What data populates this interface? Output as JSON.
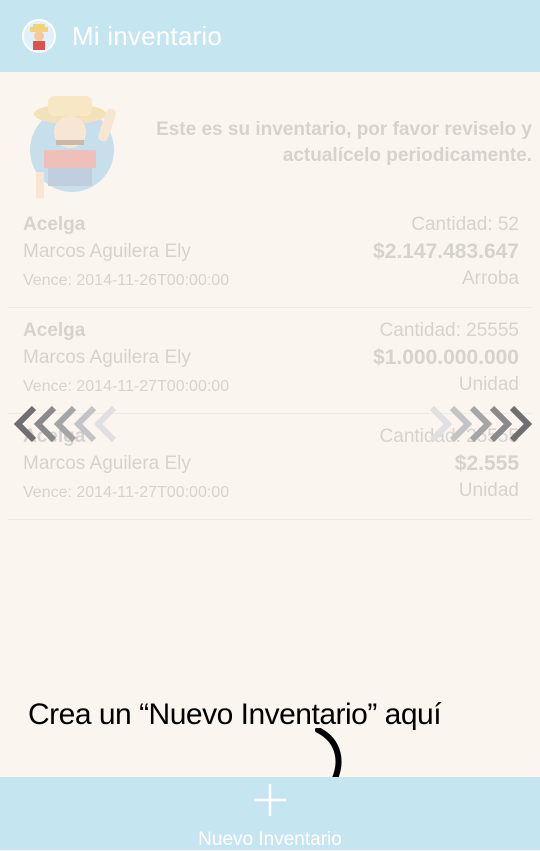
{
  "app_bar": {
    "title": "Mi inventario",
    "logo_icon": "farmer-avatar-icon"
  },
  "intro": {
    "text_line1": "Este es su inventario, por favor reviselo y",
    "text_line2": "actualícelo periodicamente."
  },
  "inventory_items": [
    {
      "name": "Acelga",
      "owner": "Marcos Aguilera Ely",
      "expires": "Vence: 2014-11-26T00:00:00",
      "quantity": "Cantidad: 52",
      "price": "$2.147.483.647",
      "unit": "Arroba"
    },
    {
      "name": "Acelga",
      "owner": "Marcos Aguilera Ely",
      "expires": "Vence: 2014-11-27T00:00:00",
      "quantity": "Cantidad: 25555",
      "price": "$1.000.000.000",
      "unit": "Unidad"
    },
    {
      "name": "Acelga",
      "owner": "Marcos Aguilera Ely",
      "expires": "Vence: 2014-11-27T00:00:00",
      "quantity": "Cantidad: 25555",
      "price": "$2.555",
      "unit": "Unidad"
    }
  ],
  "tutorial": {
    "hint": "Crea un “Nuevo Inventario” aquí"
  },
  "bottom_bar": {
    "label": "Nuevo Inventario",
    "icon": "plus-icon"
  },
  "colors": {
    "bar": "#c5e5f1",
    "background": "#faf5ee"
  }
}
